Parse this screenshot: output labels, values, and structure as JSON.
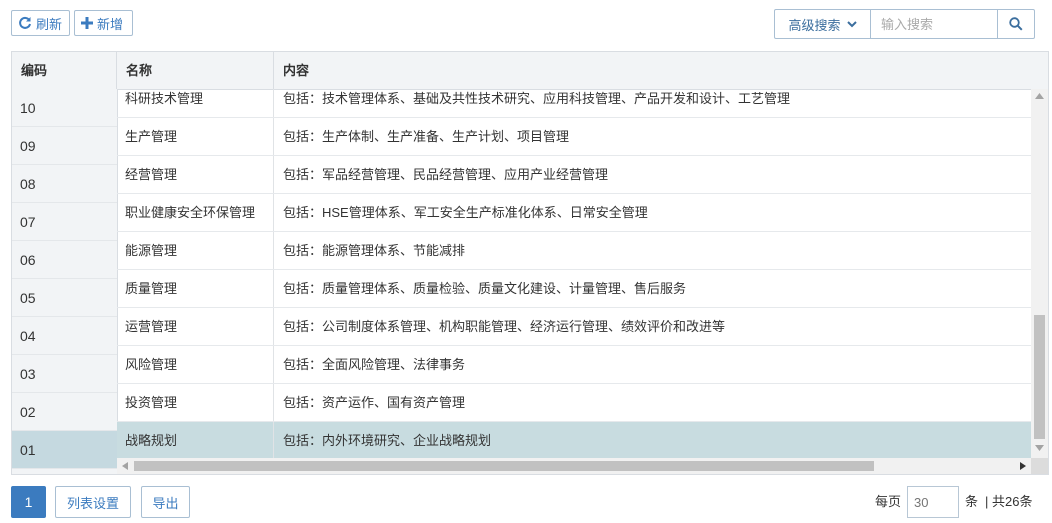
{
  "toolbar": {
    "refresh_label": "刷新",
    "add_label": "新增",
    "advanced_search_label": "高级搜索",
    "search_placeholder": "输入搜索"
  },
  "table": {
    "columns": [
      "编码",
      "名称",
      "内容"
    ],
    "rows": [
      {
        "code": "10",
        "name": "科研技术管理",
        "content": "包括：技术管理体系、基础及共性技术研究、应用科技管理、产品开发和设计、工艺管理"
      },
      {
        "code": "09",
        "name": "生产管理",
        "content": "包括：生产体制、生产准备、生产计划、项目管理"
      },
      {
        "code": "08",
        "name": "经营管理",
        "content": "包括：军品经营管理、民品经营管理、应用产业经营管理"
      },
      {
        "code": "07",
        "name": "职业健康安全环保管理",
        "content": "包括：HSE管理体系、军工安全生产标准化体系、日常安全管理"
      },
      {
        "code": "06",
        "name": "能源管理",
        "content": "包括：能源管理体系、节能减排"
      },
      {
        "code": "05",
        "name": "质量管理",
        "content": "包括：质量管理体系、质量检验、质量文化建设、计量管理、售后服务"
      },
      {
        "code": "04",
        "name": "运营管理",
        "content": "包括：公司制度体系管理、机构职能管理、经济运行管理、绩效评价和改进等"
      },
      {
        "code": "03",
        "name": "风险管理",
        "content": "包括：全面风险管理、法律事务"
      },
      {
        "code": "02",
        "name": "投资管理",
        "content": "包括：资产运作、国有资产管理"
      },
      {
        "code": "01",
        "name": "战略规划",
        "content": "包括：内外环境研究、企业战略规划"
      }
    ],
    "selected_index": 9
  },
  "footer": {
    "current_page": "1",
    "list_settings_label": "列表设置",
    "export_label": "导出",
    "per_page_label": "每页",
    "per_page_value": "30",
    "unit_label": "条",
    "total_label": "| 共26条"
  },
  "colors": {
    "accent": "#3b7bbf",
    "selected_row": "#c8dce0",
    "header_bg": "#f2f4f6"
  }
}
